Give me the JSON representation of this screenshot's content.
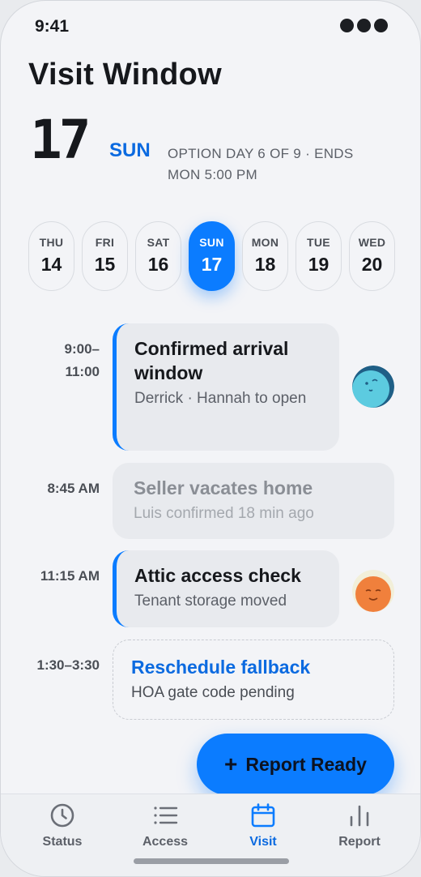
{
  "status_bar": {
    "time": "9:41"
  },
  "header": {
    "title": "Visit Window",
    "date_number": "17",
    "day_of_week": "SUN",
    "subtitle": "OPTION DAY 6 OF 9 · ENDS MON 5:00 PM"
  },
  "days": [
    {
      "dow": "THU",
      "num": "14"
    },
    {
      "dow": "FRI",
      "num": "15"
    },
    {
      "dow": "SAT",
      "num": "16"
    },
    {
      "dow": "SUN",
      "num": "17",
      "selected": true
    },
    {
      "dow": "MON",
      "num": "18"
    },
    {
      "dow": "TUE",
      "num": "19"
    },
    {
      "dow": "WED",
      "num": "20"
    }
  ],
  "events": [
    {
      "time_line1": "9:00–",
      "time_line2": "11:00",
      "title": "Confirmed arrival window",
      "subtitle": "Derrick · Hannah to open",
      "avatar": "teal-avatar"
    },
    {
      "time": "8:45 AM",
      "title": "Seller vacates home",
      "subtitle": "Luis confirmed 18 min ago"
    },
    {
      "time": "11:15 AM",
      "title": "Attic access check",
      "subtitle": "Tenant storage moved",
      "avatar": "orange-avatar"
    },
    {
      "time": "1:30–3:30",
      "title": "Reschedule fallback",
      "subtitle": "HOA gate code pending"
    }
  ],
  "fab": {
    "icon": "plus",
    "label": "Report Ready"
  },
  "tabs": [
    {
      "label": "Status",
      "icon": "clock-icon"
    },
    {
      "label": "Access",
      "icon": "list-icon"
    },
    {
      "label": "Visit",
      "icon": "calendar-icon",
      "active": true
    },
    {
      "label": "Report",
      "icon": "bar-chart-icon"
    }
  ],
  "colors": {
    "accent": "#0b7cff",
    "accent_text": "#0b6ae0",
    "card": "#e8eaee",
    "background": "#f3f4f7"
  }
}
